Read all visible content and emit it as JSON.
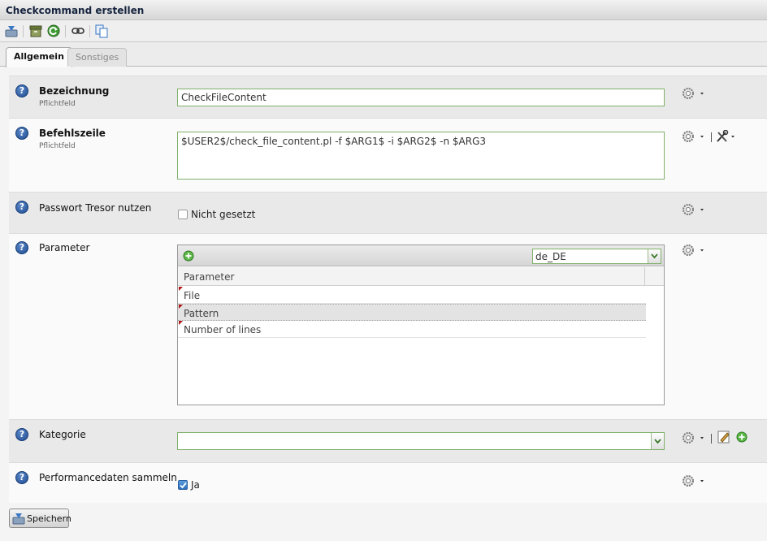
{
  "window": {
    "title": "Checkcommand erstellen"
  },
  "toolbar": {
    "icons": [
      "save-icon",
      "archive-icon",
      "refresh-icon",
      "link-icon",
      "copy-icon"
    ]
  },
  "tabs": [
    {
      "label": "Allgemein",
      "active": true
    },
    {
      "label": "Sonstiges",
      "active": false
    }
  ],
  "form": {
    "name": {
      "label": "Bezeichnung",
      "required": "Pflichtfeld",
      "value": "CheckFileContent"
    },
    "command": {
      "label": "Befehlszeile",
      "required": "Pflichtfeld",
      "value": "$USER2$/check_file_content.pl -f $ARG1$ -i $ARG2$ -n $ARG3"
    },
    "vault": {
      "label": "Passwort Tresor nutzen",
      "checkbox_label": "Nicht gesetzt",
      "checked": false
    },
    "parameter": {
      "label": "Parameter",
      "language": "de_DE",
      "column_header": "Parameter",
      "rows": [
        "File",
        "Pattern",
        "Number of lines"
      ]
    },
    "category": {
      "label": "Kategorie",
      "value": ""
    },
    "perfdata": {
      "label": "Performancedaten sammeln",
      "checkbox_label": "Ja",
      "checked": true
    }
  },
  "buttons": {
    "save": "Speichern"
  },
  "colors": {
    "field_border": "#7fb069",
    "help_icon": "#1f4d92",
    "title_text": "#15233e"
  }
}
